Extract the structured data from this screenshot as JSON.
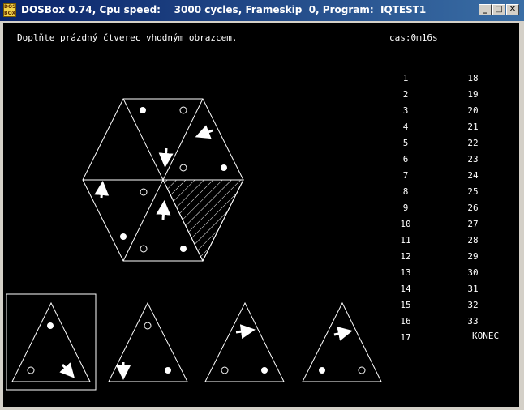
{
  "window": {
    "icon_label": "DOS BOX",
    "title": "DOSBox 0.74, Cpu speed:    3000 cycles, Frameskip  0, Program:  IQTEST1",
    "buttons": {
      "minimize": "_",
      "maximize": "□",
      "close": "✕"
    }
  },
  "game": {
    "instruction": "Doplňte prázdný čtverec vhodným obrazcem.",
    "timer": "cas:0m16s",
    "numbers_col1": [
      "1",
      "2",
      "3",
      "4",
      "5",
      "6",
      "7",
      "8",
      "9",
      "10",
      "11",
      "12",
      "13",
      "14",
      "15",
      "16",
      "17"
    ],
    "numbers_col2": [
      "18",
      "19",
      "20",
      "21",
      "22",
      "23",
      "24",
      "25",
      "26",
      "27",
      "28",
      "29",
      "30",
      "31",
      "32",
      "33"
    ],
    "exit_label": "KONEC",
    "selected_option": 1,
    "colors": {
      "background": "#000000",
      "foreground": "#ffffff",
      "titlebar": "#0a246a"
    }
  }
}
